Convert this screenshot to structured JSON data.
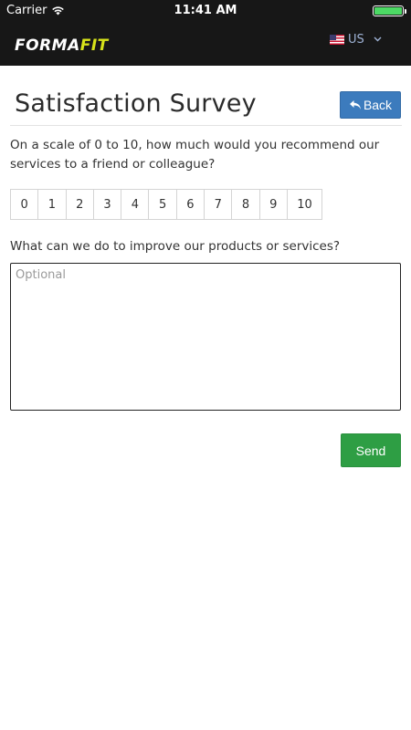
{
  "status_bar": {
    "carrier": "Carrier",
    "time": "11:41 AM",
    "icons": [
      "wifi-icon",
      "battery-icon"
    ]
  },
  "header": {
    "logo_part1": "FORMA",
    "logo_part2": "FIT",
    "language": "US",
    "colors": {
      "bar": "#171717",
      "logo_accent": "#d7e31a"
    }
  },
  "page": {
    "title": "Satisfaction Survey",
    "back_label": "Back"
  },
  "survey": {
    "question1": "On a scale of 0 to 10, how much would you recommend our services to a friend or colleague?",
    "scale": [
      "0",
      "1",
      "2",
      "3",
      "4",
      "5",
      "6",
      "7",
      "8",
      "9",
      "10"
    ],
    "question2": "What can we do to improve our products or services?",
    "comment_placeholder": "Optional",
    "comment_value": "",
    "send_label": "Send"
  },
  "colors": {
    "back_button": "#3c7bbd",
    "send_button": "#2e9e44"
  }
}
